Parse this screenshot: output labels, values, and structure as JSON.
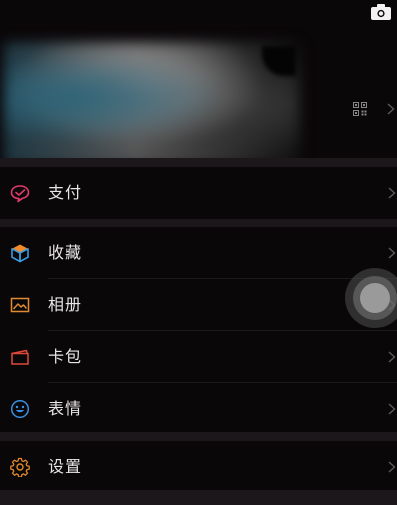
{
  "colors": {
    "background": "#0a0709",
    "divider": "#1b171a",
    "label": "#e8e6e7",
    "chevron": "#5a5759",
    "pay_icon": "#e23a6c",
    "favorites_icon_blue": "#3a9be0",
    "favorites_icon_orange": "#f08a2a",
    "album_icon": "#e08a32",
    "cards_icon": "#e0483a",
    "stickers_icon": "#3a8fe0",
    "settings_icon": "#e0882a"
  },
  "header": {
    "camera_icon": "camera-icon"
  },
  "profile": {
    "qr_icon": "qr-code-icon",
    "chevron_icon": "chevron-right-icon"
  },
  "menu": {
    "pay": {
      "label": "支付",
      "icon": "pay-icon"
    },
    "favorites": {
      "label": "收藏",
      "icon": "favorites-cube-icon"
    },
    "album": {
      "label": "相册",
      "icon": "album-picture-icon"
    },
    "cards": {
      "label": "卡包",
      "icon": "card-wallet-icon"
    },
    "stickers": {
      "label": "表情",
      "icon": "smiley-icon"
    },
    "settings": {
      "label": "设置",
      "icon": "gear-icon"
    }
  },
  "assistive_touch": {
    "icon": "assistive-touch-icon"
  }
}
